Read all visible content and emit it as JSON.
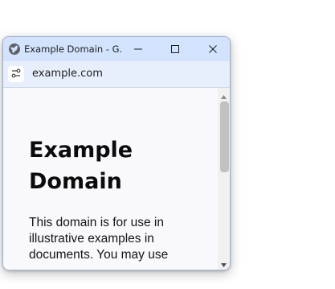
{
  "window": {
    "title": "Example Domain - G...",
    "controls": {
      "minimize_icon": "minimize-icon",
      "maximize_icon": "maximize-icon",
      "close_icon": "close-icon"
    }
  },
  "address_bar": {
    "site_info_icon": "site-settings-icon",
    "url": "example.com"
  },
  "page": {
    "heading": "Example Domain",
    "paragraph": "This domain is for use in illustrative examples in documents. You may use"
  },
  "colors": {
    "titlebar": "#d3e3fd",
    "address_bar": "#e8effc",
    "page_background": "#f9f9fd",
    "scroll_thumb": "#c1c1c1"
  }
}
